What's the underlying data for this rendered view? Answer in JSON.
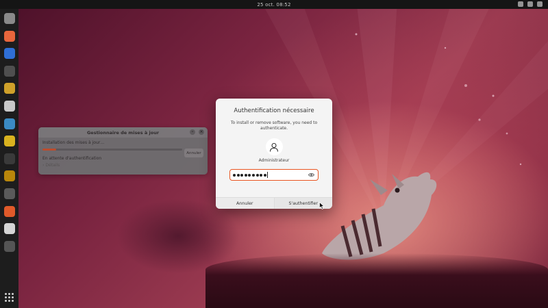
{
  "topbar": {
    "clock": "25 oct. 08:52"
  },
  "update_window": {
    "title": "Gestionnaire de mises à jour",
    "installing_label": "Installation des mises à jour…",
    "progress": 0.1,
    "cancel_label": "Annuler",
    "status": "En attente d'authentification",
    "details_label": "Détails"
  },
  "auth_dialog": {
    "title": "Authentification nécessaire",
    "message": "To install or remove software, you need to authenticate.",
    "username": "Administrateur",
    "password_length": 9,
    "cancel_label": "Annuler",
    "authenticate_label": "S'authentifier"
  },
  "colors": {
    "accent": "#e95420",
    "dock_bg": "#1d1d1d",
    "topbar_bg": "#151515"
  },
  "dock": {
    "apps": [
      {
        "name": "files-icon",
        "color": "#8a8a8a"
      },
      {
        "name": "firefox-icon",
        "color": "#e8663c"
      },
      {
        "name": "thunderbird-icon",
        "color": "#2f6fd6"
      },
      {
        "name": "writer-icon",
        "color": "#4f4f4f"
      },
      {
        "name": "notes-icon",
        "color": "#cfa12a"
      },
      {
        "name": "impress-icon",
        "color": "#c8c8c8"
      },
      {
        "name": "image-viewer-icon",
        "color": "#3b8bc4"
      },
      {
        "name": "rhythmbox-icon",
        "color": "#d9b21f"
      },
      {
        "name": "sync-icon",
        "color": "#3a3a3a"
      },
      {
        "name": "numbat-icon",
        "color": "#b8860b"
      },
      {
        "name": "updater-icon",
        "color": "#5a5a5a"
      },
      {
        "name": "software-icon",
        "color": "#e05a2a"
      },
      {
        "name": "storage-icon",
        "color": "#d5d5d5"
      },
      {
        "name": "trash-icon",
        "color": "#555555"
      }
    ]
  }
}
